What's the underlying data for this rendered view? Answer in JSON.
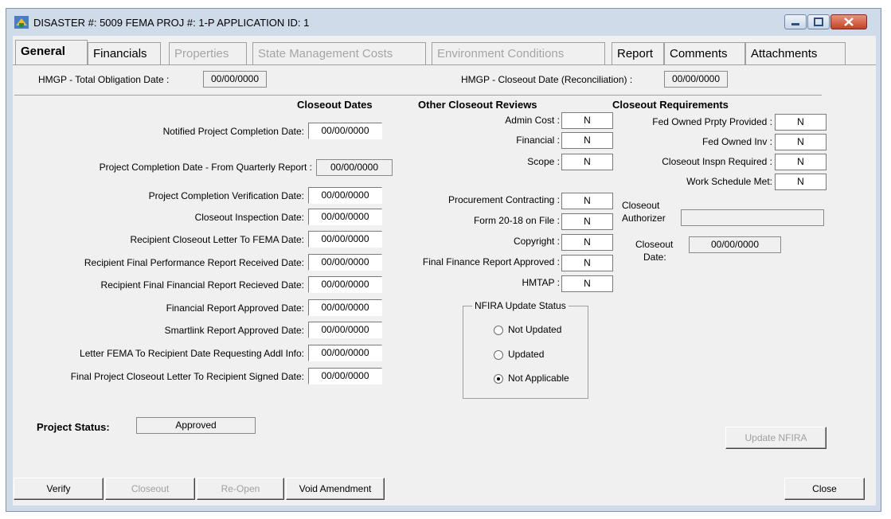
{
  "window": {
    "title": "DISASTER #: 5009  FEMA PROJ #: 1-P  APPLICATION ID: 1"
  },
  "tabs": [
    "General",
    "Financials",
    "Properties",
    "State Management Costs",
    "Environment Conditions",
    "Report",
    "Comments",
    "Attachments"
  ],
  "header": {
    "total_obligation_label": "HMGP - Total Obligation Date :",
    "total_obligation_value": "00/00/0000",
    "closeout_reconciliation_label": "HMGP - Closeout Date (Reconciliation) :",
    "closeout_reconciliation_value": "00/00/0000"
  },
  "closeout_dates": {
    "heading": "Closeout Dates",
    "rows": [
      {
        "label": "Notified Project  Completion Date:",
        "value": "00/00/0000"
      },
      {
        "label": "Project Completion Date - From Quarterly Report :",
        "value": "00/00/0000"
      },
      {
        "label": "Project Completion Verification Date:",
        "value": "00/00/0000"
      },
      {
        "label": "Closeout Inspection Date:",
        "value": "00/00/0000"
      },
      {
        "label": "Recipient Closeout  Letter To FEMA Date:",
        "value": "00/00/0000"
      },
      {
        "label": "Recipient Final Performance Report Received  Date:",
        "value": "00/00/0000"
      },
      {
        "label": "Recipient Final Financial Report Recieved Date:",
        "value": "00/00/0000"
      },
      {
        "label": "Financial Report Approved Date:",
        "value": "00/00/0000"
      },
      {
        "label": "Smartlink Report Approved Date:",
        "value": "00/00/0000"
      },
      {
        "label": "Letter FEMA To Recipient Date Requesting Addl Info:",
        "value": "00/00/0000"
      },
      {
        "label": "Final Project Closeout Letter To Recipient Signed Date:",
        "value": "00/00/0000"
      }
    ]
  },
  "other_reviews": {
    "heading": "Other Closeout Reviews",
    "rows": [
      {
        "label": "Admin Cost :",
        "value": "N"
      },
      {
        "label": "Financial :",
        "value": "N"
      },
      {
        "label": "Scope :",
        "value": "N"
      },
      {
        "label": "Procurement Contracting  :",
        "value": "N"
      },
      {
        "label": "Form 20-18 on File :",
        "value": "N"
      },
      {
        "label": "Copyright :",
        "value": "N"
      },
      {
        "label": "Final Finance Report Approved :",
        "value": "N"
      },
      {
        "label": "HMTAP :",
        "value": "N"
      }
    ]
  },
  "nfira": {
    "legend": "NFIRA Update Status",
    "options": [
      "Not Updated",
      "Updated",
      "Not Applicable"
    ],
    "selected": "Not Applicable"
  },
  "requirements": {
    "heading": "Closeout Requirements",
    "rows": [
      {
        "label": "Fed Owned Prpty Provided :",
        "value": "N"
      },
      {
        "label": "Fed Owned Inv :",
        "value": "N"
      },
      {
        "label": "Closeout Inspn Required :",
        "value": "N"
      },
      {
        "label": "Work Schedule Met:",
        "value": "N"
      }
    ],
    "authorizer_label_1": "Closeout",
    "authorizer_label_2": "Authorizer",
    "authorizer_value": "",
    "closeout_date_label_1": "Closeout",
    "closeout_date_label_2": "Date:",
    "closeout_date_value": "00/00/0000"
  },
  "project_status": {
    "label": "Project Status:",
    "value": "Approved"
  },
  "buttons": {
    "update_nfira": "Update NFIRA",
    "verify": "Verify",
    "closeout": "Closeout",
    "reopen": "Re-Open",
    "void_amendment": "Void Amendment",
    "close": "Close"
  }
}
